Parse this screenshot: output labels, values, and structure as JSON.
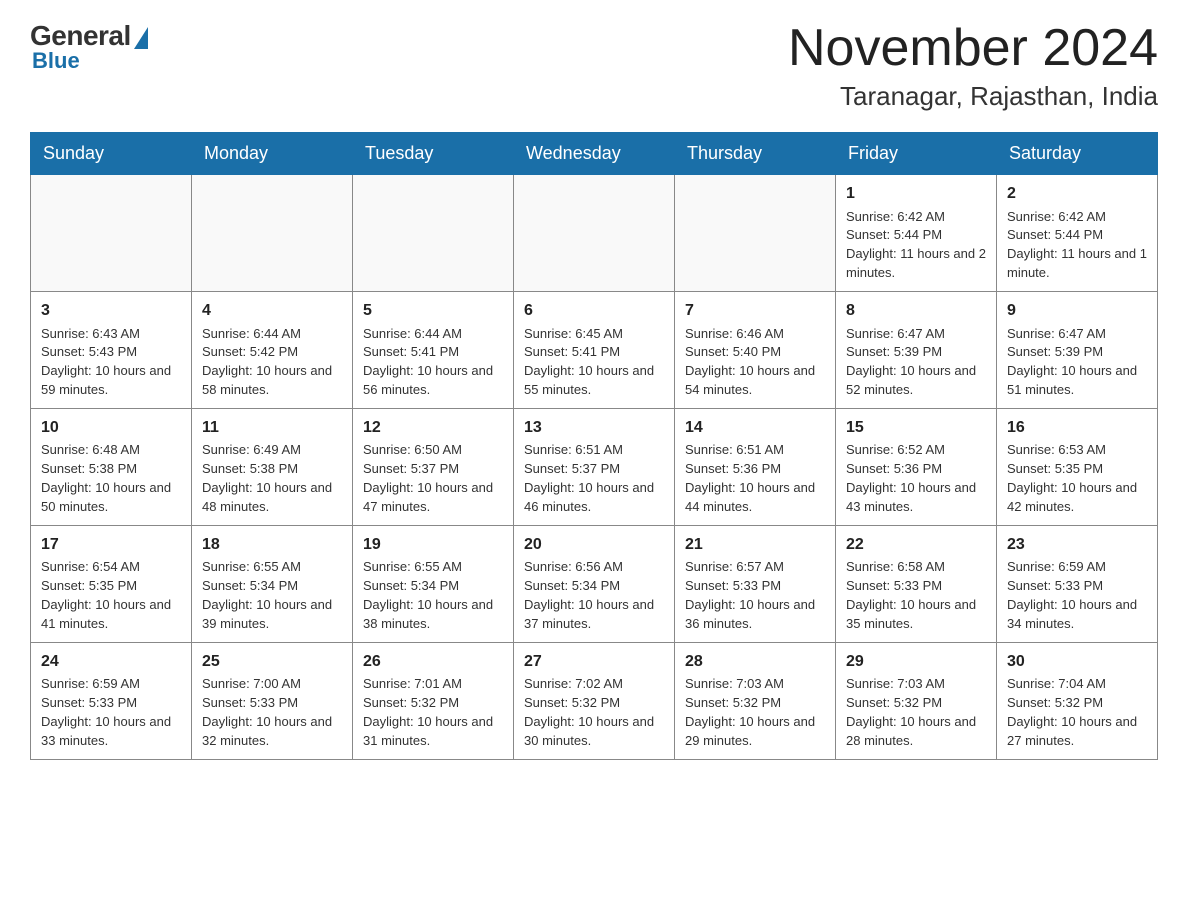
{
  "logo": {
    "general": "General",
    "blue": "Blue",
    "sub": "Blue"
  },
  "header": {
    "month_year": "November 2024",
    "location": "Taranagar, Rajasthan, India"
  },
  "weekdays": [
    "Sunday",
    "Monday",
    "Tuesday",
    "Wednesday",
    "Thursday",
    "Friday",
    "Saturday"
  ],
  "weeks": [
    [
      {
        "day": "",
        "info": ""
      },
      {
        "day": "",
        "info": ""
      },
      {
        "day": "",
        "info": ""
      },
      {
        "day": "",
        "info": ""
      },
      {
        "day": "",
        "info": ""
      },
      {
        "day": "1",
        "info": "Sunrise: 6:42 AM\nSunset: 5:44 PM\nDaylight: 11 hours and 2 minutes."
      },
      {
        "day": "2",
        "info": "Sunrise: 6:42 AM\nSunset: 5:44 PM\nDaylight: 11 hours and 1 minute."
      }
    ],
    [
      {
        "day": "3",
        "info": "Sunrise: 6:43 AM\nSunset: 5:43 PM\nDaylight: 10 hours and 59 minutes."
      },
      {
        "day": "4",
        "info": "Sunrise: 6:44 AM\nSunset: 5:42 PM\nDaylight: 10 hours and 58 minutes."
      },
      {
        "day": "5",
        "info": "Sunrise: 6:44 AM\nSunset: 5:41 PM\nDaylight: 10 hours and 56 minutes."
      },
      {
        "day": "6",
        "info": "Sunrise: 6:45 AM\nSunset: 5:41 PM\nDaylight: 10 hours and 55 minutes."
      },
      {
        "day": "7",
        "info": "Sunrise: 6:46 AM\nSunset: 5:40 PM\nDaylight: 10 hours and 54 minutes."
      },
      {
        "day": "8",
        "info": "Sunrise: 6:47 AM\nSunset: 5:39 PM\nDaylight: 10 hours and 52 minutes."
      },
      {
        "day": "9",
        "info": "Sunrise: 6:47 AM\nSunset: 5:39 PM\nDaylight: 10 hours and 51 minutes."
      }
    ],
    [
      {
        "day": "10",
        "info": "Sunrise: 6:48 AM\nSunset: 5:38 PM\nDaylight: 10 hours and 50 minutes."
      },
      {
        "day": "11",
        "info": "Sunrise: 6:49 AM\nSunset: 5:38 PM\nDaylight: 10 hours and 48 minutes."
      },
      {
        "day": "12",
        "info": "Sunrise: 6:50 AM\nSunset: 5:37 PM\nDaylight: 10 hours and 47 minutes."
      },
      {
        "day": "13",
        "info": "Sunrise: 6:51 AM\nSunset: 5:37 PM\nDaylight: 10 hours and 46 minutes."
      },
      {
        "day": "14",
        "info": "Sunrise: 6:51 AM\nSunset: 5:36 PM\nDaylight: 10 hours and 44 minutes."
      },
      {
        "day": "15",
        "info": "Sunrise: 6:52 AM\nSunset: 5:36 PM\nDaylight: 10 hours and 43 minutes."
      },
      {
        "day": "16",
        "info": "Sunrise: 6:53 AM\nSunset: 5:35 PM\nDaylight: 10 hours and 42 minutes."
      }
    ],
    [
      {
        "day": "17",
        "info": "Sunrise: 6:54 AM\nSunset: 5:35 PM\nDaylight: 10 hours and 41 minutes."
      },
      {
        "day": "18",
        "info": "Sunrise: 6:55 AM\nSunset: 5:34 PM\nDaylight: 10 hours and 39 minutes."
      },
      {
        "day": "19",
        "info": "Sunrise: 6:55 AM\nSunset: 5:34 PM\nDaylight: 10 hours and 38 minutes."
      },
      {
        "day": "20",
        "info": "Sunrise: 6:56 AM\nSunset: 5:34 PM\nDaylight: 10 hours and 37 minutes."
      },
      {
        "day": "21",
        "info": "Sunrise: 6:57 AM\nSunset: 5:33 PM\nDaylight: 10 hours and 36 minutes."
      },
      {
        "day": "22",
        "info": "Sunrise: 6:58 AM\nSunset: 5:33 PM\nDaylight: 10 hours and 35 minutes."
      },
      {
        "day": "23",
        "info": "Sunrise: 6:59 AM\nSunset: 5:33 PM\nDaylight: 10 hours and 34 minutes."
      }
    ],
    [
      {
        "day": "24",
        "info": "Sunrise: 6:59 AM\nSunset: 5:33 PM\nDaylight: 10 hours and 33 minutes."
      },
      {
        "day": "25",
        "info": "Sunrise: 7:00 AM\nSunset: 5:33 PM\nDaylight: 10 hours and 32 minutes."
      },
      {
        "day": "26",
        "info": "Sunrise: 7:01 AM\nSunset: 5:32 PM\nDaylight: 10 hours and 31 minutes."
      },
      {
        "day": "27",
        "info": "Sunrise: 7:02 AM\nSunset: 5:32 PM\nDaylight: 10 hours and 30 minutes."
      },
      {
        "day": "28",
        "info": "Sunrise: 7:03 AM\nSunset: 5:32 PM\nDaylight: 10 hours and 29 minutes."
      },
      {
        "day": "29",
        "info": "Sunrise: 7:03 AM\nSunset: 5:32 PM\nDaylight: 10 hours and 28 minutes."
      },
      {
        "day": "30",
        "info": "Sunrise: 7:04 AM\nSunset: 5:32 PM\nDaylight: 10 hours and 27 minutes."
      }
    ]
  ]
}
